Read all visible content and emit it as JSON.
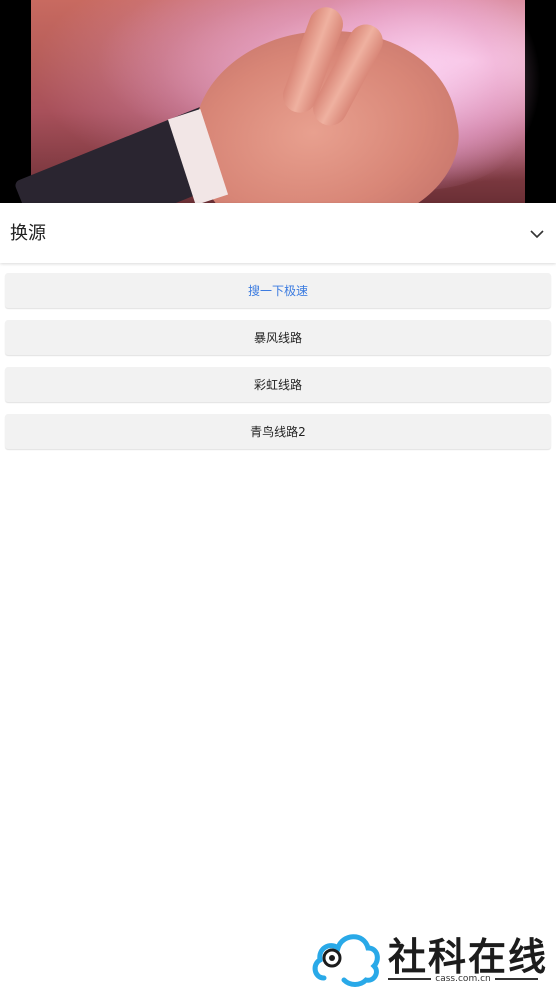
{
  "header": {
    "title": "换源"
  },
  "sources": [
    {
      "label": "搜一下极速",
      "active": true
    },
    {
      "label": "暴风线路",
      "active": false
    },
    {
      "label": "彩虹线路",
      "active": false
    },
    {
      "label": "青鸟线路2",
      "active": false
    }
  ],
  "watermark": {
    "text": "社科在线",
    "url": "cass.com.cn"
  },
  "colors": {
    "accent": "#3b7be0",
    "button_bg": "#f2f2f2",
    "logo_blue": "#29a9e8"
  },
  "icons": {
    "collapse": "chevron-down-icon"
  }
}
